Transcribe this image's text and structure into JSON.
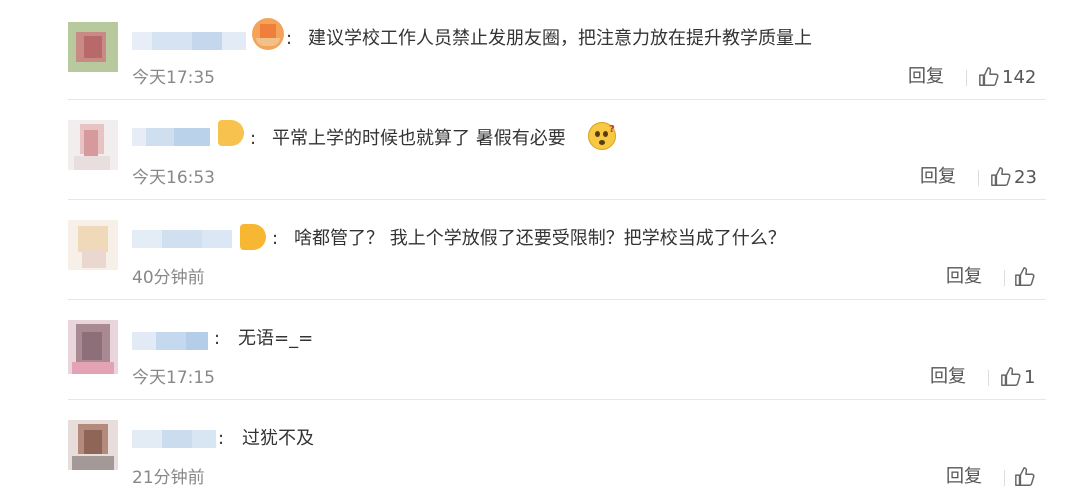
{
  "comments": [
    {
      "text": "建议学校工作人员禁止发朋友圈，把注意力放在提升教学质量上",
      "separator": ":",
      "time": "今天17:35",
      "reply_label": "回复",
      "likes": "142",
      "emoji": "grinning-emoji-icon"
    },
    {
      "text": "平常上学的时候也就算了 暑假有必要",
      "separator": ":",
      "time": "今天16:53",
      "reply_label": "回复",
      "likes": "23",
      "emoji": "confused-emoji-icon"
    },
    {
      "text": "啥都管了？ 我上个学放假了还要受限制？把学校当成了什么？",
      "separator": ":",
      "time": "40分钟前",
      "reply_label": "回复",
      "likes": ""
    },
    {
      "text": "无语=_=",
      "separator": ":",
      "time": "今天17:15",
      "reply_label": "回复",
      "likes": "1"
    },
    {
      "text": "过犹不及",
      "separator": ":",
      "time": "21分钟前",
      "reply_label": "回复",
      "likes": ""
    }
  ],
  "colors": {
    "blur_name": "#c9dbef",
    "text": "#333333",
    "meta": "#888888",
    "divider": "#e6e6e6",
    "emoji_yellow": "#f6b93b"
  }
}
